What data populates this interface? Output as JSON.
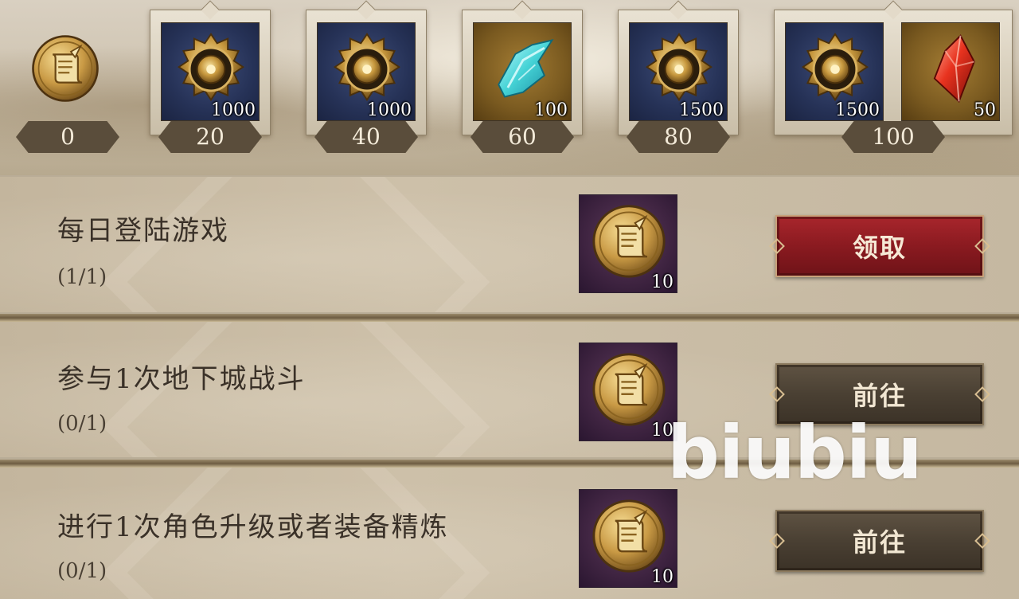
{
  "progress": {
    "current_points": "0",
    "current_icon": "scroll-coin-icon"
  },
  "milestones": [
    {
      "threshold": "20",
      "rewards": [
        {
          "icon": "gold-shield-medallion-icon",
          "qty": "1000",
          "bg": "blue"
        }
      ]
    },
    {
      "threshold": "40",
      "rewards": [
        {
          "icon": "gold-shield-medallion-icon",
          "qty": "1000",
          "bg": "blue"
        }
      ]
    },
    {
      "threshold": "60",
      "rewards": [
        {
          "icon": "cyan-crystal-shard-icon",
          "qty": "100",
          "bg": "gold"
        }
      ]
    },
    {
      "threshold": "80",
      "rewards": [
        {
          "icon": "gold-shield-medallion-icon",
          "qty": "1500",
          "bg": "blue"
        }
      ]
    },
    {
      "threshold": "100",
      "rewards": [
        {
          "icon": "gold-shield-medallion-icon",
          "qty": "1500",
          "bg": "blue"
        },
        {
          "icon": "red-crystal-gem-icon",
          "qty": "50",
          "bg": "gold"
        }
      ]
    }
  ],
  "tasks": [
    {
      "title": "每日登陆游戏",
      "progress": "(1/1)",
      "reward_icon": "scroll-coin-icon",
      "reward_qty": "10",
      "button": "领取",
      "button_style": "claim"
    },
    {
      "title": "参与1次地下城战斗",
      "progress": "(0/1)",
      "reward_icon": "scroll-coin-icon",
      "reward_qty": "10",
      "button": "前往",
      "button_style": "go"
    },
    {
      "title": "进行1次角色升级或者装备精炼",
      "progress": "(0/1)",
      "reward_icon": "scroll-coin-icon",
      "reward_qty": "10",
      "button": "前往",
      "button_style": "go"
    }
  ],
  "watermark": "biubiu",
  "colors": {
    "claim_button": "#8a1a20",
    "go_button": "#4a4033",
    "threshold_badge": "#5a4d3b",
    "text_dark": "#3a3128"
  }
}
